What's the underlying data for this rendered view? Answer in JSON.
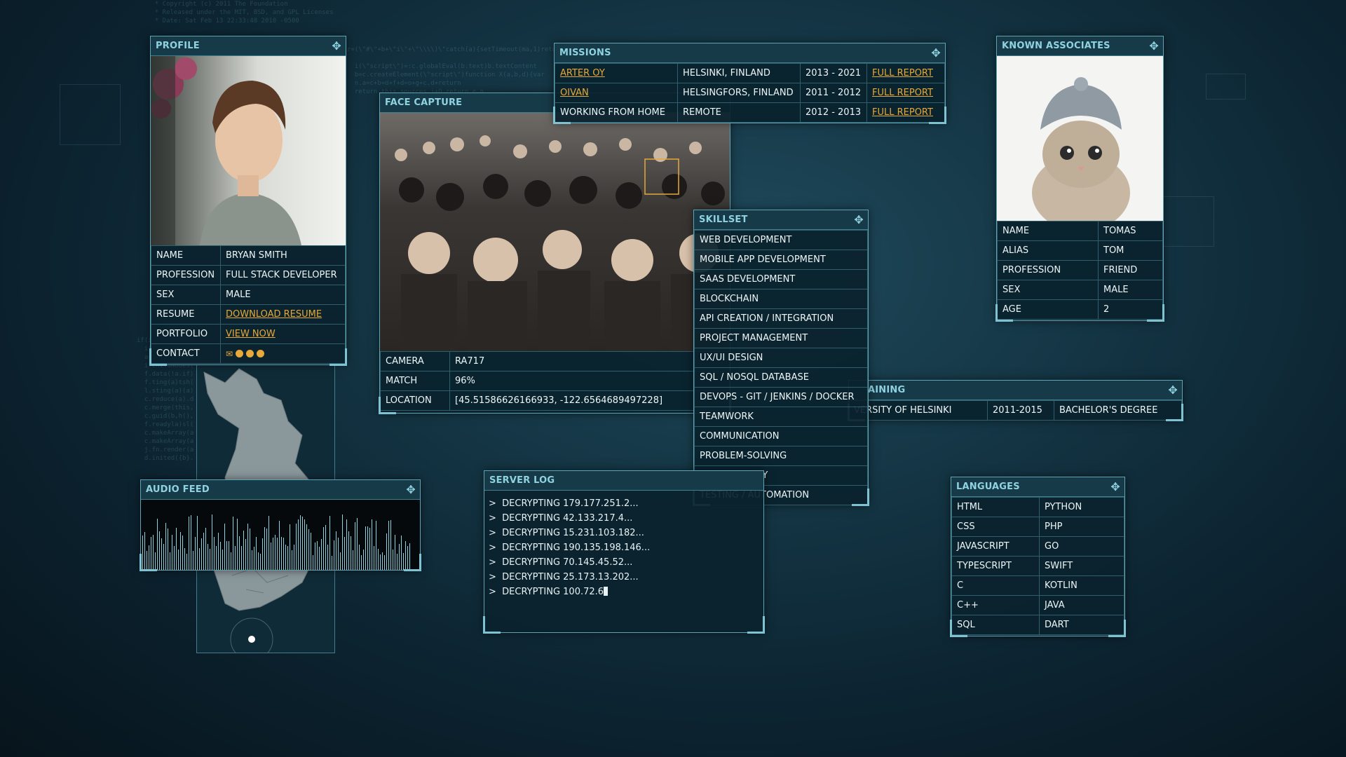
{
  "profile": {
    "title": "PROFILE",
    "rows": [
      {
        "label": "NAME",
        "value": "BRYAN SMITH"
      },
      {
        "label": "PROFESSION",
        "value": "FULL STACK DEVELOPER"
      },
      {
        "label": "SEX",
        "value": "MALE"
      },
      {
        "label": "RESUME",
        "value": "DOWNLOAD RESUME"
      },
      {
        "label": "PORTFOLIO",
        "value": "VIEW NOW"
      },
      {
        "label": "CONTACT",
        "value": ""
      }
    ]
  },
  "missions": {
    "title": "MISSIONS",
    "rows": [
      {
        "company": "ARTER OY",
        "location": "HELSINKI, FINLAND",
        "years": "2013 - 2021",
        "report": "FULL REPORT"
      },
      {
        "company": "OIVAN",
        "location": "HELSINGFORS, FINLAND",
        "years": "2011 - 2012",
        "report": "FULL REPORT"
      },
      {
        "company": "WORKING FROM HOME",
        "location": "REMOTE",
        "years": "2012 - 2013",
        "report": "FULL REPORT"
      }
    ]
  },
  "face_capture": {
    "title": "FACE CAPTURE",
    "rows": [
      {
        "label": "CAMERA",
        "value": "RA717"
      },
      {
        "label": "MATCH",
        "value": "96%"
      },
      {
        "label": "LOCATION",
        "value": "[45.51586626166933, -122.6564689497228]"
      }
    ]
  },
  "skillset": {
    "title": "SKILLSET",
    "items": [
      "WEB DEVELOPMENT",
      "MOBILE APP DEVELOPMENT",
      "SAAS DEVELOPMENT",
      "BLOCKCHAIN",
      "API CREATION / INTEGRATION",
      "PROJECT MANAGEMENT",
      "UX/UI DESIGN",
      "SQL / NOSQL DATABASE",
      "DEVOPS - GIT / JENKINS / DOCKER",
      "TEAMWORK",
      "COMMUNICATION",
      "PROBLEM-SOLVING",
      "CODE QUALITY",
      "TESTING / AUTOMATION"
    ]
  },
  "associates": {
    "title": "KNOWN ASSOCIATES",
    "rows": [
      {
        "label": "NAME",
        "value": "TOMAS"
      },
      {
        "label": "ALIAS",
        "value": "TOM"
      },
      {
        "label": "PROFESSION",
        "value": "FRIEND"
      },
      {
        "label": "SEX",
        "value": "MALE"
      },
      {
        "label": "AGE",
        "value": "2"
      }
    ]
  },
  "training": {
    "title": "AINING",
    "school": "VERSITY OF HELSINKI",
    "years": "2011-2015",
    "degree": "BACHELOR'S DEGREE"
  },
  "audio": {
    "title": "AUDIO FEED"
  },
  "server_log": {
    "title": "SERVER LOG",
    "lines": [
      "DECRYPTING 179.177.251.2...",
      "DECRYPTING 42.133.217.4...",
      "DECRYPTING 15.231.103.182...",
      "DECRYPTING 190.135.198.146...",
      "DECRYPTING 70.145.45.52...",
      "DECRYPTING 25.173.13.202...",
      "DECRYPTING 100.72.6"
    ],
    "prompt": ">"
  },
  "languages": {
    "title": "LANGUAGES",
    "rows": [
      [
        "HTML",
        "PYTHON"
      ],
      [
        "CSS",
        "PHP"
      ],
      [
        "JAVASCRIPT",
        "GO"
      ],
      [
        "TYPESCRIPT",
        "SWIFT"
      ],
      [
        "C",
        "KOTLIN"
      ],
      [
        "C++",
        "JAVA"
      ],
      [
        "SQL",
        "DART"
      ]
    ]
  },
  "icons": {
    "move": "move-icon",
    "mail": "mail-icon",
    "skype": "skype-icon",
    "telegram": "telegram-icon",
    "github": "github-icon"
  },
  "colors": {
    "accent": "#8fd2e0",
    "link": "#e6a93a",
    "border": "#5fa4b4"
  }
}
